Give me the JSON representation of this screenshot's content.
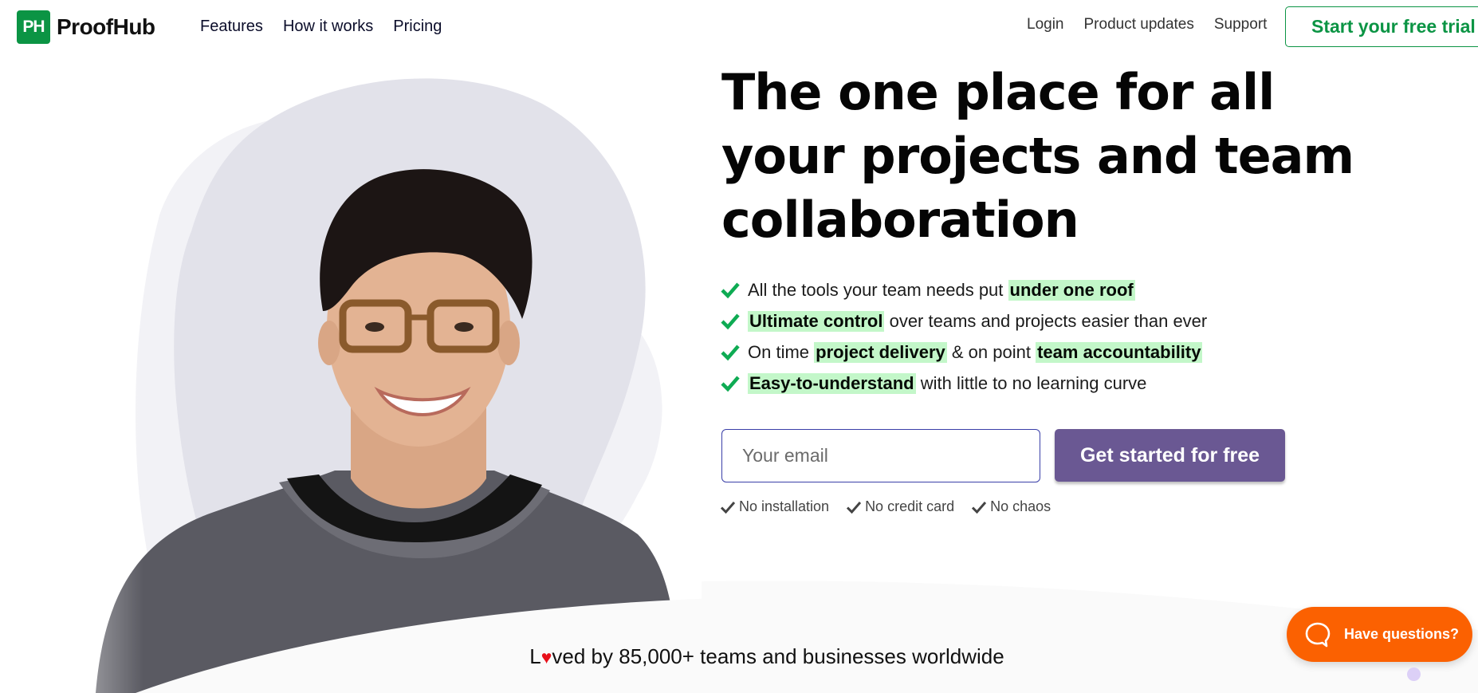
{
  "brand": {
    "logo_mark": "PH",
    "name": "ProofHub",
    "primary_color": "#0b9444"
  },
  "nav": {
    "left_links": [
      "Features",
      "How it works",
      "Pricing"
    ],
    "right_links": [
      "Login",
      "Product updates",
      "Support"
    ],
    "trial_button": "Start your free trial"
  },
  "hero": {
    "image_alt": "smiling woman with glasses",
    "headline": "The one place for all your projects and team collaboration",
    "features": [
      [
        {
          "t": "All the tools your team needs put ",
          "h": false
        },
        {
          "t": "under one roof",
          "h": true
        }
      ],
      [
        {
          "t": "Ultimate control",
          "h": true
        },
        {
          "t": " over teams and projects easier than ever",
          "h": false
        }
      ],
      [
        {
          "t": "On time ",
          "h": false
        },
        {
          "t": "project delivery",
          "h": true
        },
        {
          "t": " & on point ",
          "h": false
        },
        {
          "t": "team accountability",
          "h": true
        }
      ],
      [
        {
          "t": "Easy-to-understand",
          "h": true
        },
        {
          "t": " with little to no learning curve",
          "h": false
        }
      ]
    ],
    "highlight_color": "#c3f7c9",
    "check_color": "#0eab53"
  },
  "signup": {
    "email_placeholder": "Your email",
    "email_value": "",
    "cta_label": "Get started for free",
    "cta_color": "#6a5893",
    "perks": [
      "No installation",
      "No credit card",
      "No chaos"
    ]
  },
  "social_proof": {
    "prefix": "L",
    "heart_icon": "♥",
    "suffix": "ved by 85,000+ teams and businesses worldwide"
  },
  "chat": {
    "label": "Have questions?",
    "color": "#fb6101"
  }
}
